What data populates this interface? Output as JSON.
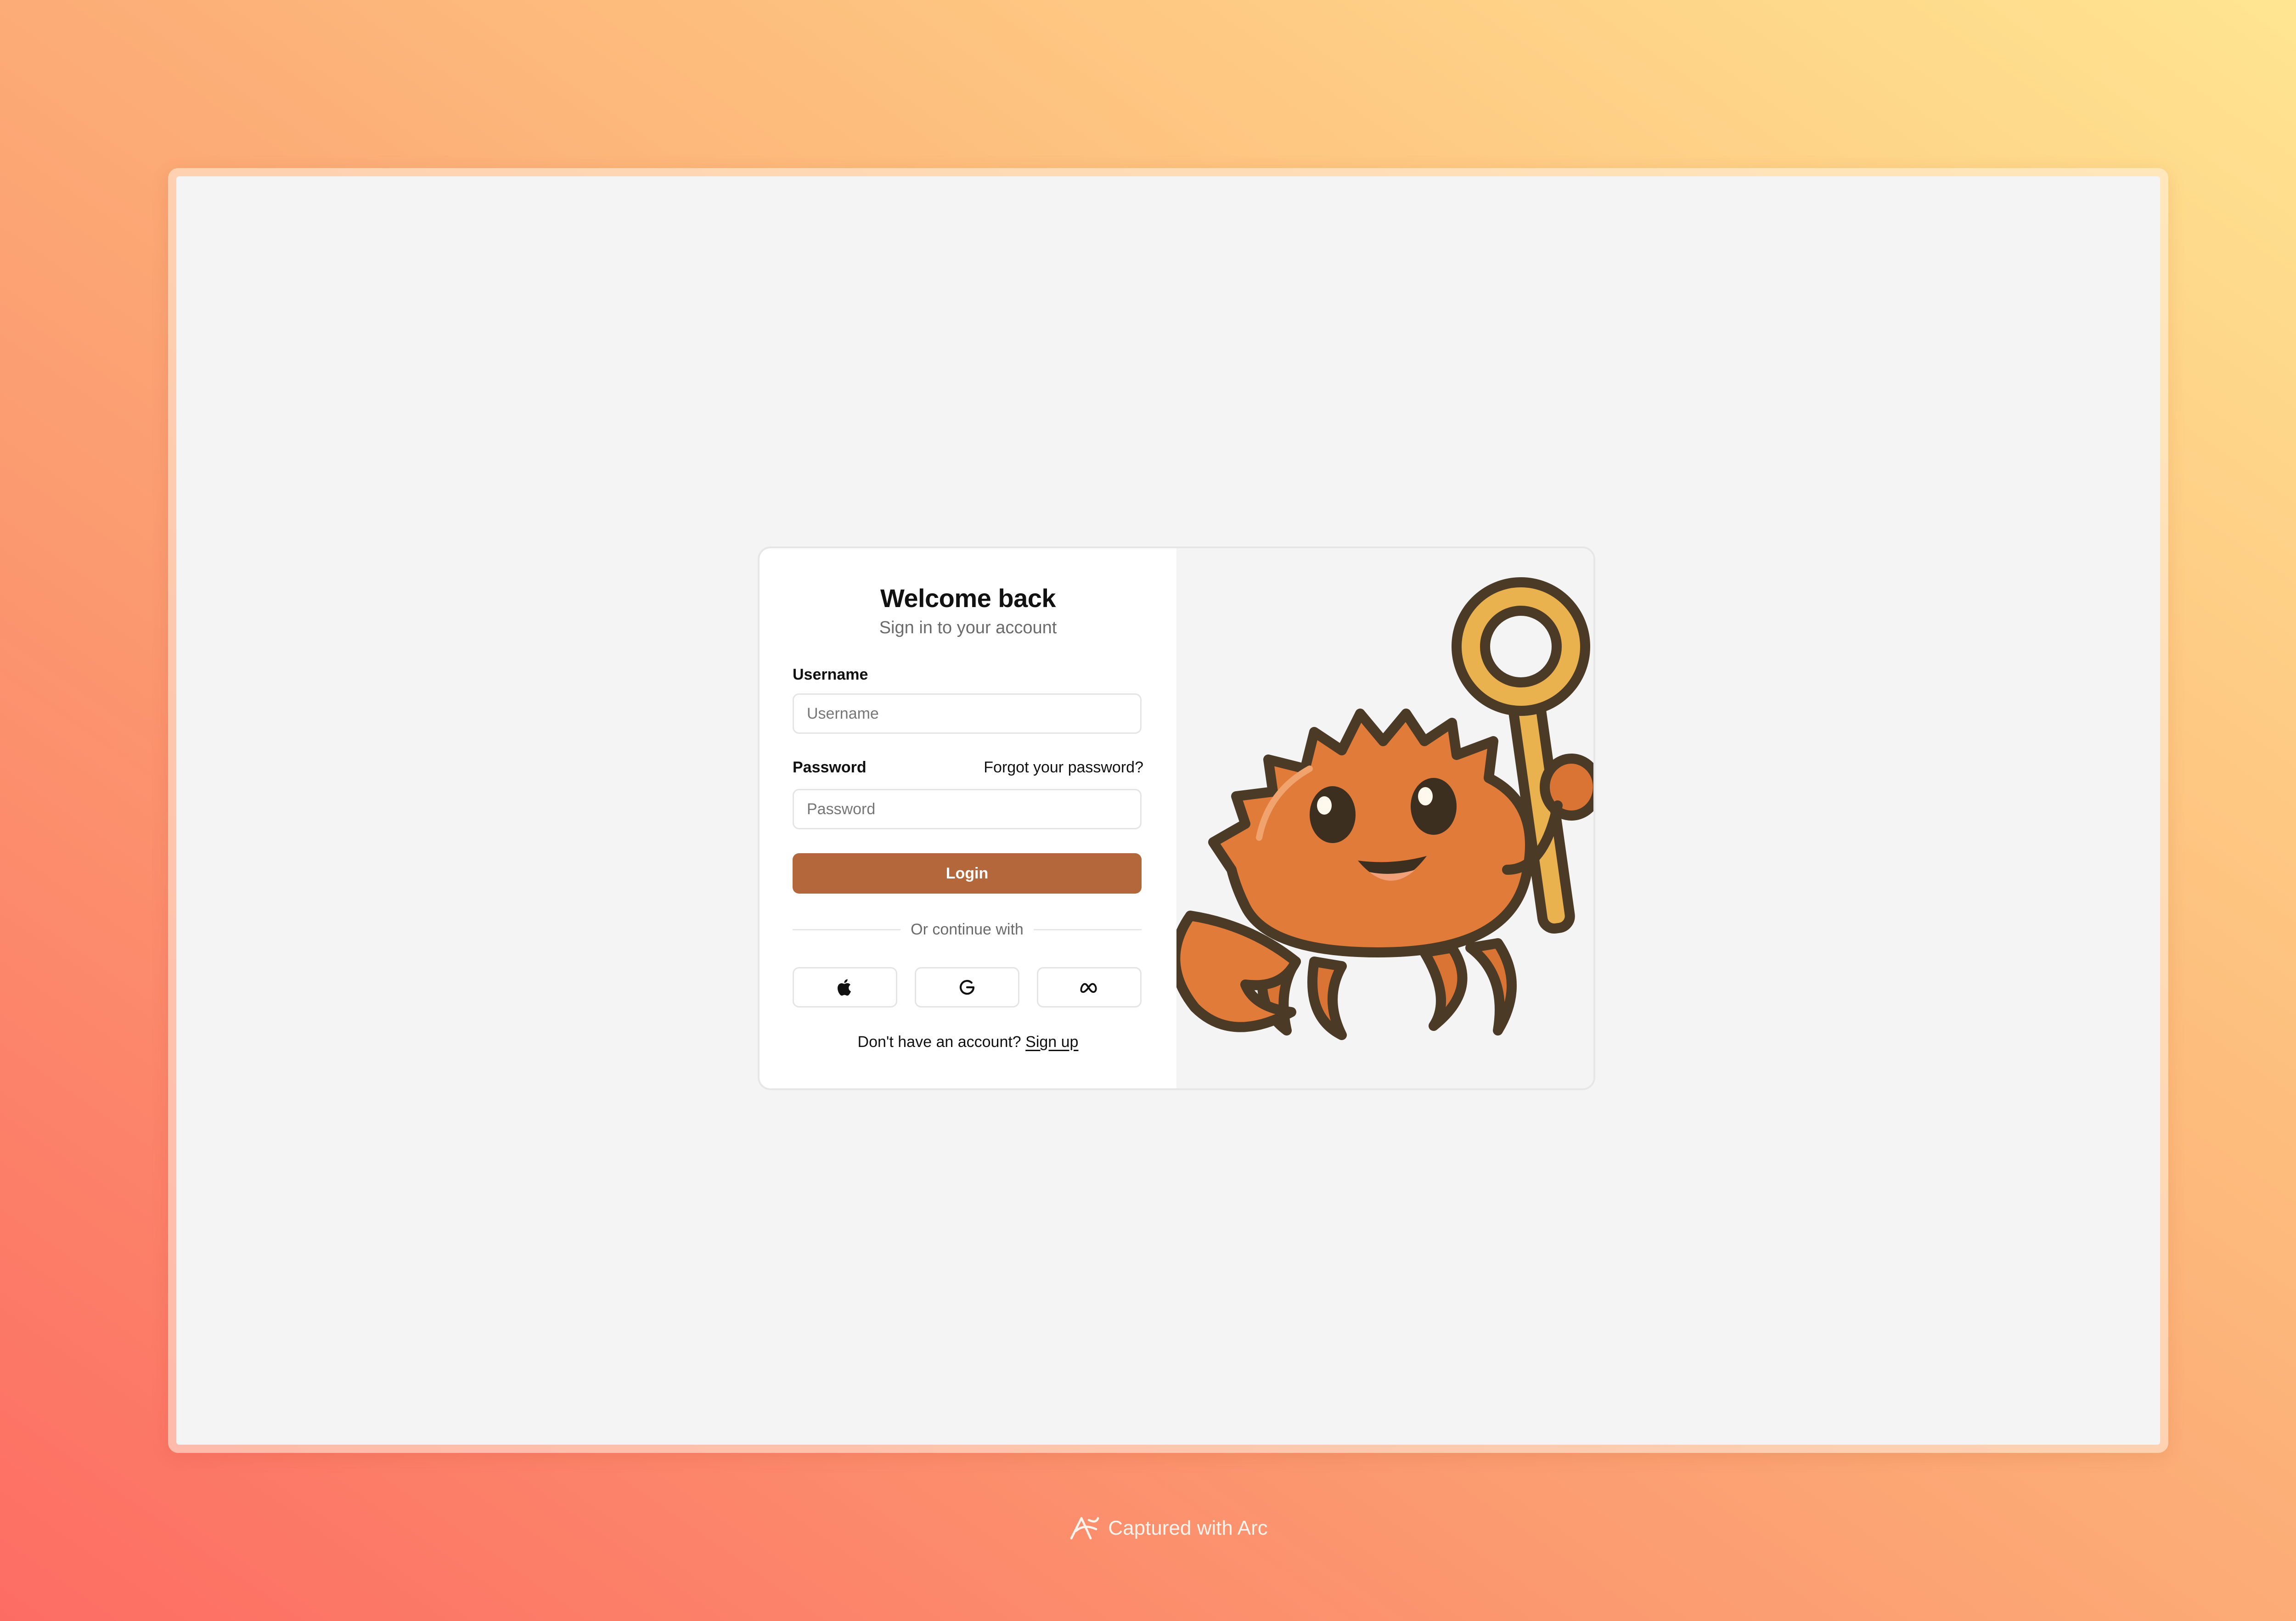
{
  "login": {
    "title": "Welcome back",
    "subtitle": "Sign in to your account",
    "username_label": "Username",
    "username_placeholder": "Username",
    "username_value": "",
    "password_label": "Password",
    "password_placeholder": "Password",
    "password_value": "",
    "forgot_link": "Forgot your password?",
    "login_button": "Login",
    "divider_text": "Or continue with",
    "social_buttons": [
      {
        "icon": "apple-icon"
      },
      {
        "icon": "google-icon"
      },
      {
        "icon": "meta-icon"
      }
    ],
    "signup_prompt": "Don't have an account?",
    "signup_link": "Sign up"
  },
  "illustration": {
    "subject": "crab-mascot-holding-key",
    "colors": {
      "shell": "#e07b39",
      "outline": "#4a3a26",
      "key": "#e9b24e"
    }
  },
  "footer": {
    "text": "Captured with Arc"
  },
  "colors": {
    "accent": "#b3673a",
    "card_bg": "#ffffff",
    "page_bg": "#f4f4f4"
  }
}
